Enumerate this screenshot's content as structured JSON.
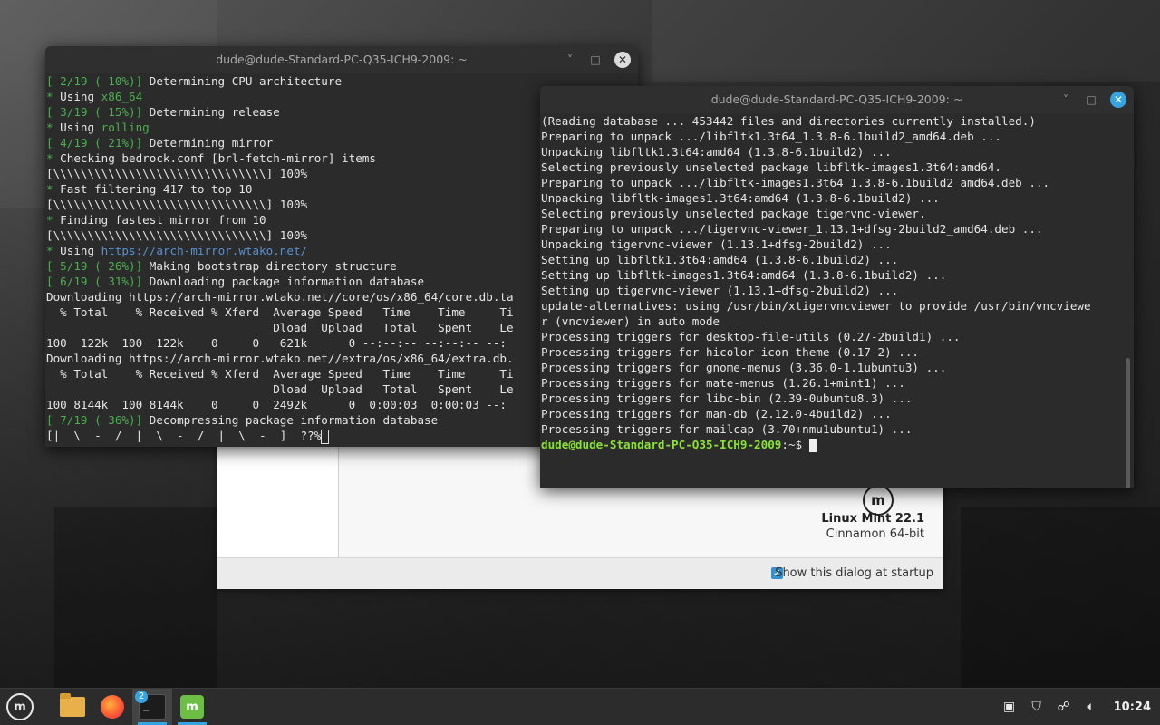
{
  "colors": {
    "accent": "#35a4e0",
    "terminal_bg": "#2b2b2b",
    "progress_green": "#4caf50",
    "prompt_green": "#8ae234"
  },
  "welcome": {
    "os_name": "Linux Mint 22.1",
    "edition": "Cinnamon 64-bit",
    "badge_glyph": "m",
    "show_at_startup_label": "Show this dialog at startup",
    "show_at_startup_checked": true
  },
  "term1": {
    "title": "dude@dude-Standard-PC-Q35-ICH9-2009: ~",
    "minimize": "˅",
    "maximize": "□",
    "close": "✕",
    "lines": [
      {
        "prefix": "[ 2/19 ( 10%)]",
        "text": " Determining CPU architecture"
      },
      {
        "prefix": "*",
        "text": " Using ",
        "value": "x86_64"
      },
      {
        "prefix": "[ 3/19 ( 15%)]",
        "text": " Determining release"
      },
      {
        "prefix": "*",
        "text": " Using ",
        "value": "rolling"
      },
      {
        "prefix": "[ 4/19 ( 21%)]",
        "text": " Determining mirror"
      },
      {
        "prefix": "*",
        "text": " Checking bedrock.conf [brl-fetch-mirror] items"
      },
      {
        "text": "[\\\\\\\\\\\\\\\\\\\\\\\\\\\\\\\\\\\\\\\\\\\\\\\\\\\\\\\\\\\\\\] 100%"
      },
      {
        "prefix": "*",
        "text": " Fast filtering 417 to top 10"
      },
      {
        "text": "[\\\\\\\\\\\\\\\\\\\\\\\\\\\\\\\\\\\\\\\\\\\\\\\\\\\\\\\\\\\\\\] 100%"
      },
      {
        "prefix": "*",
        "text": " Finding fastest mirror from 10"
      },
      {
        "text": "[\\\\\\\\\\\\\\\\\\\\\\\\\\\\\\\\\\\\\\\\\\\\\\\\\\\\\\\\\\\\\\] 100%"
      },
      {
        "prefix": "*",
        "text": " Using ",
        "link": "https://arch-mirror.wtako.net/"
      },
      {
        "prefix": "[ 5/19 ( 26%)]",
        "text": " Making bootstrap directory structure"
      },
      {
        "prefix": "[ 6/19 ( 31%)]",
        "text": " Downloading package information database"
      },
      {
        "text": "Downloading https://arch-mirror.wtako.net//core/os/x86_64/core.db.ta"
      },
      {
        "text": "  % Total    % Received % Xferd  Average Speed   Time    Time     Ti"
      },
      {
        "text": "                                 Dload  Upload   Total   Spent    Le"
      },
      {
        "text": "100  122k  100  122k    0     0   621k      0 --:--:-- --:--:-- --:"
      },
      {
        "text": "Downloading https://arch-mirror.wtako.net//extra/os/x86_64/extra.db."
      },
      {
        "text": "  % Total    % Received % Xferd  Average Speed   Time    Time     Ti"
      },
      {
        "text": "                                 Dload  Upload   Total   Spent    Le"
      },
      {
        "text": "100 8144k  100 8144k    0     0  2492k      0  0:00:03  0:00:03 --:"
      },
      {
        "prefix": "[ 7/19 ( 36%)]",
        "text": " Decompressing package information database"
      },
      {
        "text": "[|  \\  -  /  |  \\  -  /  |  \\  -  ]  ??%"
      }
    ]
  },
  "term2": {
    "title": "dude@dude-Standard-PC-Q35-ICH9-2009: ~",
    "minimize": "˅",
    "maximize": "□",
    "close": "✕",
    "lines": [
      "(Reading database ... 453442 files and directories currently installed.)",
      "Preparing to unpack .../libfltk1.3t64_1.3.8-6.1build2_amd64.deb ...",
      "Unpacking libfltk1.3t64:amd64 (1.3.8-6.1build2) ...",
      "Selecting previously unselected package libfltk-images1.3t64:amd64.",
      "Preparing to unpack .../libfltk-images1.3t64_1.3.8-6.1build2_amd64.deb ...",
      "Unpacking libfltk-images1.3t64:amd64 (1.3.8-6.1build2) ...",
      "Selecting previously unselected package tigervnc-viewer.",
      "Preparing to unpack .../tigervnc-viewer_1.13.1+dfsg-2build2_amd64.deb ...",
      "Unpacking tigervnc-viewer (1.13.1+dfsg-2build2) ...",
      "Setting up libfltk1.3t64:amd64 (1.3.8-6.1build2) ...",
      "Setting up libfltk-images1.3t64:amd64 (1.3.8-6.1build2) ...",
      "Setting up tigervnc-viewer (1.13.1+dfsg-2build2) ...",
      "update-alternatives: using /usr/bin/xtigervncviewer to provide /usr/bin/vncviewe",
      "r (vncviewer) in auto mode",
      "Processing triggers for desktop-file-utils (0.27-2build1) ...",
      "Processing triggers for hicolor-icon-theme (0.17-2) ...",
      "Processing triggers for gnome-menus (3.36.0-1.1ubuntu3) ...",
      "Processing triggers for mate-menus (1.26.1+mint1) ...",
      "Processing triggers for libc-bin (2.39-0ubuntu8.3) ...",
      "Processing triggers for man-db (2.12.0-4build2) ...",
      "Processing triggers for mailcap (3.70+nmu1ubuntu1) ..."
    ],
    "prompt": "dude@dude-Standard-PC-Q35-ICH9-2009",
    "prompt_path": ":~$ "
  },
  "taskbar": {
    "menu_glyph": "m",
    "terminal_glyph": "_",
    "terminal_badge": "2",
    "mintapp_glyph": "m",
    "clock": "10:24",
    "tray_icons": [
      "clipboard-icon",
      "shield-update-icon",
      "network-icon",
      "volume-icon"
    ]
  }
}
